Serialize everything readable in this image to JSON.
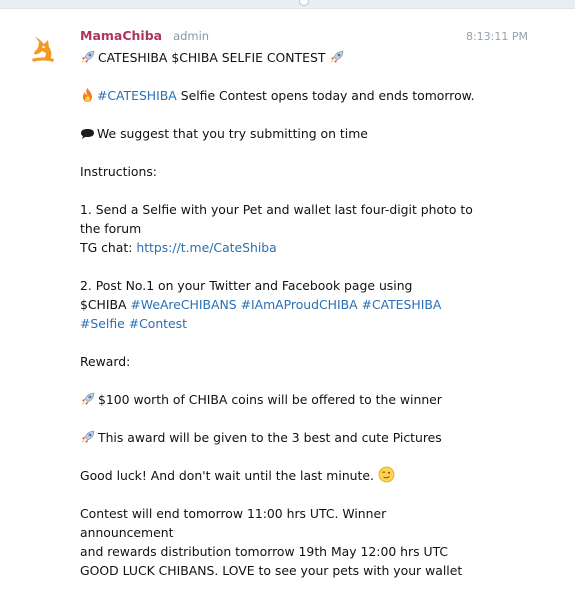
{
  "header": {
    "sender": "MamaChiba",
    "role": "admin",
    "time": "8:13:11 PM"
  },
  "message": {
    "title": "CATESHIBA $CHIBA SELFIE CONTEST",
    "line_open_tag": "#CATESHIBA",
    "line_open_text": " Selfie Contest opens today and ends tomorrow.",
    "suggest": "We suggest that you try submitting on time",
    "instructions_heading": "Instructions:",
    "step1_text": "1. Send a Selfie with your Pet and wallet last four-digit photo to the forum",
    "tg_label": "TG chat: ",
    "tg_link": "https://t.me/CateShiba",
    "step2_text": "2. Post No.1 on your Twitter and Facebook page using",
    "step2_prefix": "$CHIBA ",
    "hashtags": [
      "#WeAreCHIBANS",
      "#IAmAProudCHIBA",
      "#CATESHIBA",
      "#Selfie",
      "#Contest"
    ],
    "reward_heading": "Reward:",
    "reward1": "$100 worth of CHIBA coins will be offered to the winner",
    "reward2": "This award will be given to the 3 best and cute Pictures",
    "good_luck": "Good luck! And don't wait until the last minute. ",
    "end_line1": "Contest will end tomorrow 11:00 hrs  UTC. Winner announcement",
    "end_line2": "and rewards distribution tomorrow 19th May 12:00 hrs UTC",
    "end_line3": "GOOD LUCK CHIBANS. LOVE to see your pets with your wallet"
  },
  "icons": [
    "shiba-logo-icon",
    "rocket-icon",
    "fire-icon",
    "speech-bubble-icon",
    "wink-emoji-icon"
  ],
  "colors": {
    "sender": "#b0355a",
    "link": "#2a6fb4",
    "logo": "#f29a22",
    "meta": "#95a1ad"
  }
}
